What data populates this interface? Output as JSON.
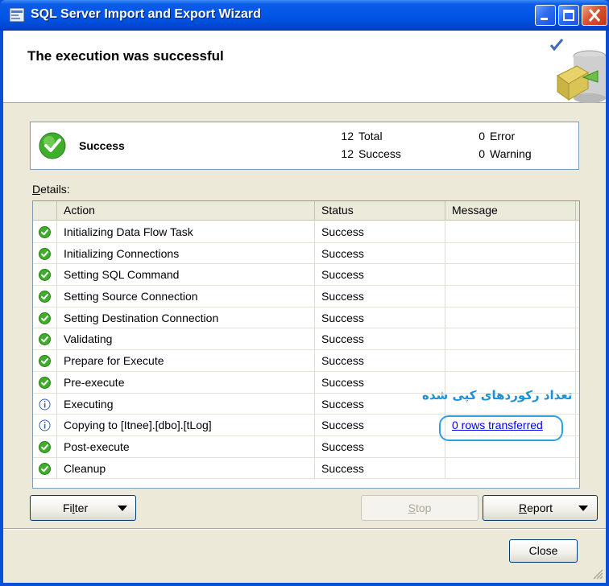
{
  "window": {
    "title": "SQL Server Import and Export Wizard"
  },
  "header": {
    "title": "The execution was successful"
  },
  "summary": {
    "status": "Success",
    "total_count": "12",
    "total_label": "Total",
    "success_count": "12",
    "success_label": "Success",
    "error_count": "0",
    "error_label": "Error",
    "warning_count": "0",
    "warning_label": "Warning"
  },
  "details": {
    "label_accel": "D",
    "label_rest": "etails:",
    "columns": {
      "action": "Action",
      "status": "Status",
      "message": "Message"
    },
    "rows": [
      {
        "icon": "success-icon",
        "action": "Initializing Data Flow Task",
        "status": "Success",
        "message": ""
      },
      {
        "icon": "success-icon",
        "action": "Initializing Connections",
        "status": "Success",
        "message": ""
      },
      {
        "icon": "success-icon",
        "action": "Setting SQL Command",
        "status": "Success",
        "message": ""
      },
      {
        "icon": "success-icon",
        "action": "Setting Source Connection",
        "status": "Success",
        "message": ""
      },
      {
        "icon": "success-icon",
        "action": "Setting Destination Connection",
        "status": "Success",
        "message": ""
      },
      {
        "icon": "success-icon",
        "action": "Validating",
        "status": "Success",
        "message": ""
      },
      {
        "icon": "success-icon",
        "action": "Prepare for Execute",
        "status": "Success",
        "message": ""
      },
      {
        "icon": "success-icon",
        "action": "Pre-execute",
        "status": "Success",
        "message": ""
      },
      {
        "icon": "info-icon",
        "action": "Executing",
        "status": "Success",
        "message": ""
      },
      {
        "icon": "info-icon",
        "action": "Copying to [Itnee].[dbo].[tLog]",
        "status": "Success",
        "message": "0 rows transferred"
      },
      {
        "icon": "success-icon",
        "action": "Post-execute",
        "status": "Success",
        "message": ""
      },
      {
        "icon": "success-icon",
        "action": "Cleanup",
        "status": "Success",
        "message": ""
      }
    ]
  },
  "annotation": {
    "text": "تعداد رکوردهای کپی شده",
    "color": "#1e90d8"
  },
  "buttons": {
    "filter_accel": "l",
    "filter_pre": "Fi",
    "filter_post": "ter",
    "stop_accel": "S",
    "stop_post": "top",
    "report_accel": "R",
    "report_post": "eport",
    "close": "Close"
  },
  "colors": {
    "titlebar": "#0055e5",
    "dialog_face": "#ece9d8",
    "success_green": "#3fae2a",
    "link": "#0000ee"
  }
}
